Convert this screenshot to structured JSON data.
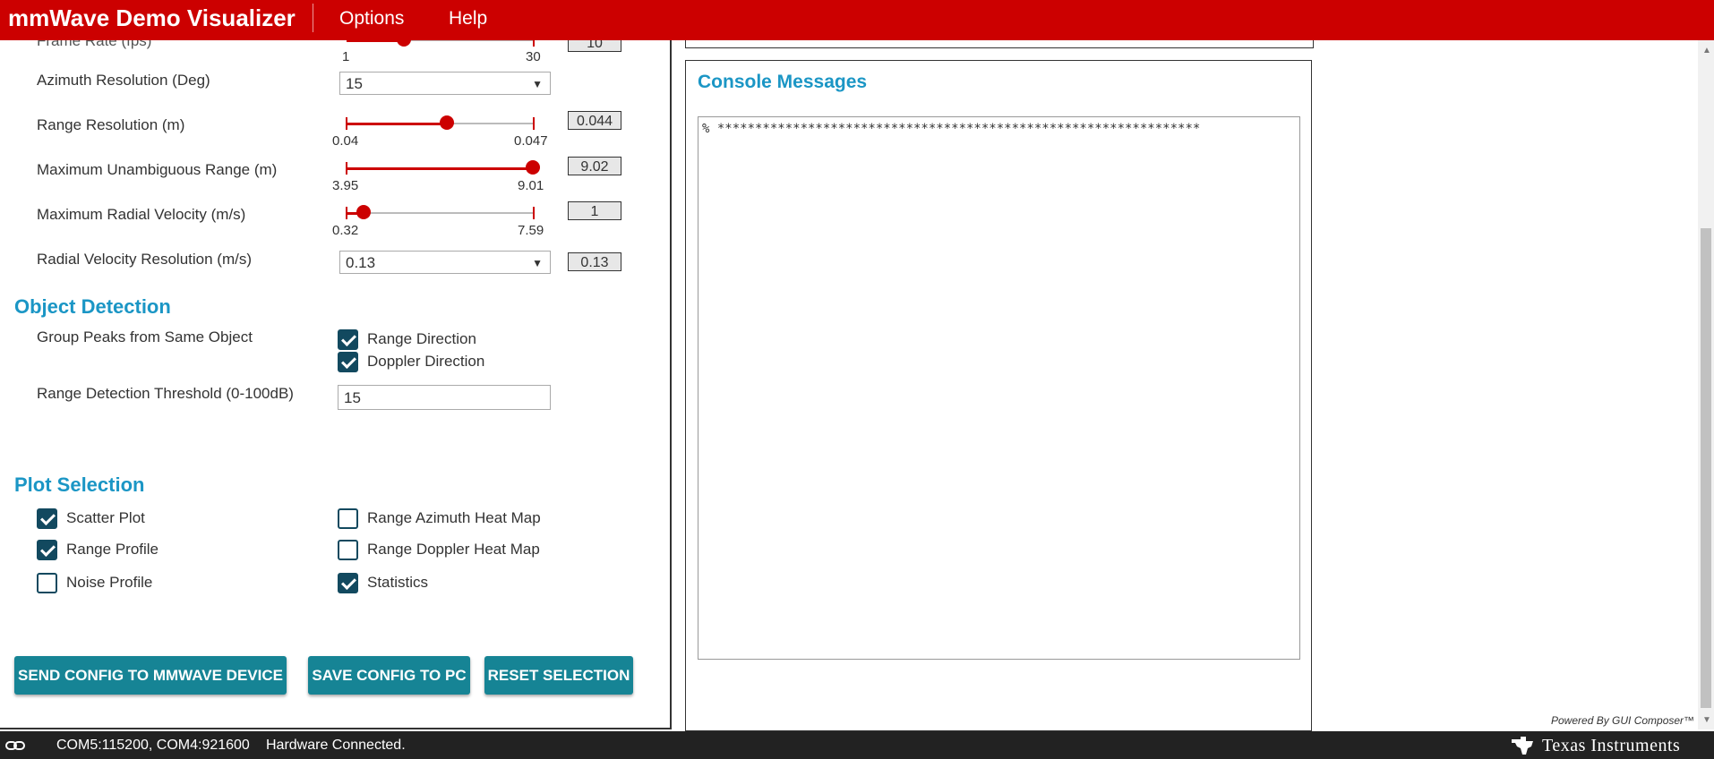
{
  "header": {
    "title": "mmWave Demo Visualizer",
    "menu": [
      "Options",
      "Help"
    ]
  },
  "config": {
    "frame_rate_label_partial": "Frame Rate (fps)",
    "frame_rate_min": "1",
    "frame_rate_max": "30",
    "frame_rate_value": "10",
    "azimuth_label": "Azimuth Resolution (Deg)",
    "azimuth_selected": "15",
    "range_res_label": "Range Resolution (m)",
    "range_res_min": "0.04",
    "range_res_max": "0.047",
    "range_res_value": "0.044",
    "max_range_label": "Maximum Unambiguous Range (m)",
    "max_range_min": "3.95",
    "max_range_max": "9.01",
    "max_range_value": "9.02",
    "max_vel_label": "Maximum Radial Velocity (m/s)",
    "max_vel_min": "0.32",
    "max_vel_max": "7.59",
    "max_vel_value": "1",
    "vel_res_label": "Radial Velocity Resolution (m/s)",
    "vel_res_selected": "0.13",
    "vel_res_value": "0.13"
  },
  "sliders": {
    "frame_rate": 0.31,
    "range_resolution": 0.54,
    "max_unambiguous_range": 1.0,
    "max_radial_velocity": 0.09
  },
  "object_detection": {
    "title": "Object Detection",
    "group_peaks_label": "Group Peaks from Same Object",
    "range_direction": {
      "label": "Range Direction",
      "checked": true
    },
    "doppler_direction": {
      "label": "Doppler Direction",
      "checked": true
    },
    "threshold_label": "Range Detection Threshold (0-100dB)",
    "threshold_value": "15"
  },
  "plot_selection": {
    "title": "Plot Selection",
    "scatter_plot": {
      "label": "Scatter Plot",
      "checked": true
    },
    "range_profile": {
      "label": "Range Profile",
      "checked": true
    },
    "noise_profile": {
      "label": "Noise Profile",
      "checked": false
    },
    "range_azimuth_heat_map": {
      "label": "Range Azimuth Heat Map",
      "checked": false
    },
    "range_doppler_heat_map": {
      "label": "Range Doppler Heat Map",
      "checked": false
    },
    "statistics": {
      "label": "Statistics",
      "checked": true
    }
  },
  "buttons": {
    "send_config": "SEND CONFIG TO MMWAVE DEVICE",
    "save_config": "SAVE CONFIG TO PC",
    "reset_selection": "RESET SELECTION"
  },
  "console": {
    "title": "Console Messages",
    "text": "% ****************************************************************"
  },
  "footer": {
    "powered_by": "Powered By GUI Composer™",
    "ports": "COM5:115200, COM4:921600",
    "hardware_status": "Hardware Connected.",
    "brand": "Texas Instruments"
  },
  "colors": {
    "header": "#cc0000",
    "accent_blue": "#1b96c5",
    "button_teal": "#168495",
    "checkbox": "#12495f",
    "status_bar": "#222222"
  }
}
